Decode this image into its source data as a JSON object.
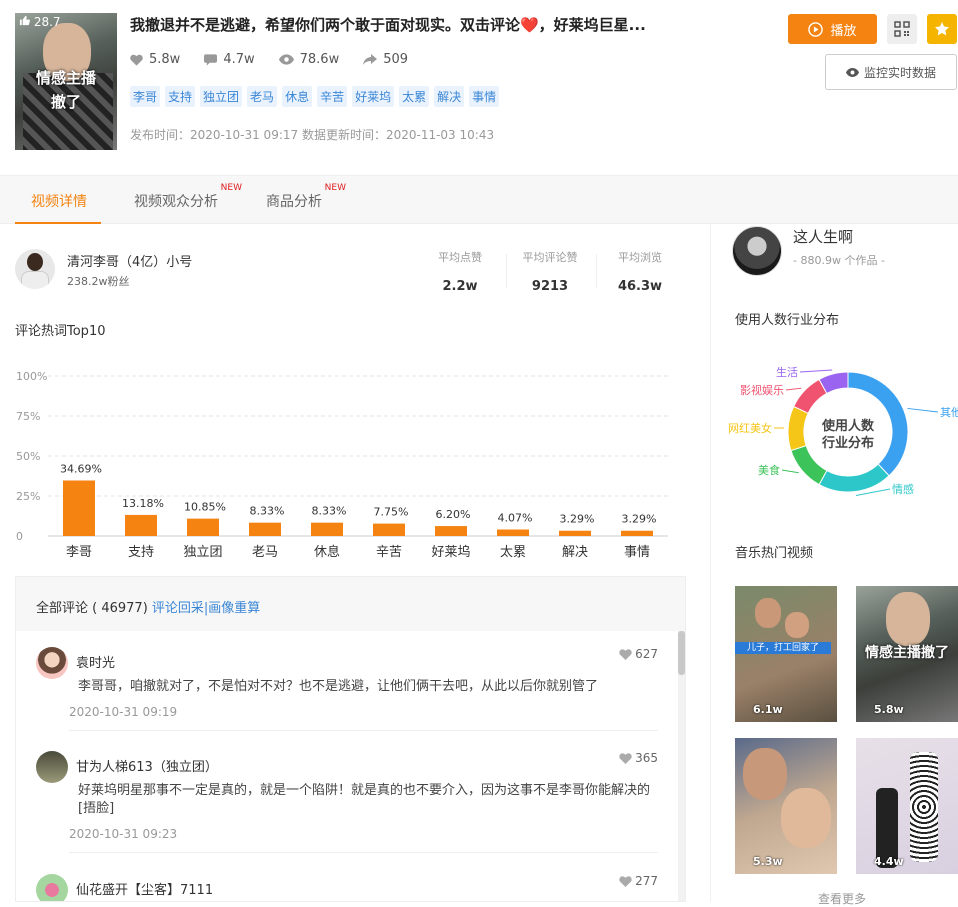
{
  "video": {
    "title": "我撤退并不是逃避，希望你们两个敢于面对现实。双击评论❤️，好莱坞巨星...",
    "score": "28.7",
    "cover_caption_1": "情感主播",
    "cover_caption_2": "撤了",
    "likes": "5.8w",
    "comments": "4.7w",
    "views": "78.6w",
    "shares": "509",
    "tags": [
      "李哥",
      "支持",
      "独立团",
      "老马",
      "休息",
      "辛苦",
      "好莱坞",
      "太累",
      "解决",
      "事情"
    ],
    "publish_info": "发布时间：2020-10-31 09:17 数据更新时间：2020-11-03 10:43"
  },
  "actions": {
    "play": "播放",
    "monitor": "监控实时数据",
    "icons": [
      "play-circle-icon",
      "qrcode-icon",
      "star-icon",
      "eye-icon"
    ]
  },
  "tabs": [
    {
      "label": "视频详情",
      "badge": ""
    },
    {
      "label": "视频观众分析",
      "badge": "NEW"
    },
    {
      "label": "商品分析",
      "badge": "NEW"
    }
  ],
  "author": {
    "name": "清河李哥（4亿）小号",
    "fans": "238.2w粉丝",
    "avg_likes_label": "平均点赞",
    "avg_likes": "2.2w",
    "avg_comment_likes_label": "平均评论赞",
    "avg_comment_likes": "9213",
    "avg_views_label": "平均浏览",
    "avg_views": "46.3w"
  },
  "hot_words_title": "评论热词Top10",
  "chart_data": {
    "type": "bar",
    "categories": [
      "李哥",
      "支持",
      "独立团",
      "老马",
      "休息",
      "辛苦",
      "好莱坞",
      "太累",
      "解决",
      "事情"
    ],
    "values": [
      34.69,
      13.18,
      10.85,
      8.33,
      8.33,
      7.75,
      6.2,
      4.07,
      3.29,
      3.29
    ],
    "data_labels": [
      "34.69%",
      "13.18%",
      "10.85%",
      "8.33%",
      "8.33%",
      "7.75%",
      "6.20%",
      "4.07%",
      "3.29%",
      "3.29%"
    ],
    "ylim": [
      0,
      100
    ],
    "yticks": [
      0,
      25,
      50,
      75,
      100
    ],
    "ytick_labels": [
      "0",
      "25%",
      "50%",
      "75%",
      "100%"
    ],
    "grid": true,
    "bar_color": "#f48311"
  },
  "comments": {
    "header_label": "全部评论 ( 46977)",
    "header_link": "评论回采|画像重算",
    "items": [
      {
        "user": "袁时光",
        "likes": "627",
        "text": "李哥哥，咱撤就对了，不是怕对不对？也不是逃避，让他们俩干去吧，从此以后你就别管了",
        "date": "2020-10-31 09:19"
      },
      {
        "user": "甘为人梯613（独立团）",
        "likes": "365",
        "text": "好莱坞明星那事不一定是真的，就是一个陷阱！就是真的也不要介入，因为这事不是李哥你能解决的[捂脸]",
        "date": "2020-10-31 09:23"
      },
      {
        "user": "仙花盛开【尘客】7111",
        "likes": "277",
        "text": "",
        "date": ""
      }
    ]
  },
  "music": {
    "name": "这人生啊",
    "works": "- 880.9w 个作品 -",
    "industry_title": "使用人数行业分布",
    "donut_center_1": "使用人数",
    "donut_center_2": "行业分布",
    "hot_videos_title": "音乐热门视频",
    "more": "查看更多",
    "industry": [
      {
        "name": "其他",
        "value": 38,
        "color": "#3aa0f0"
      },
      {
        "name": "情感",
        "value": 20,
        "color": "#2ec7c9"
      },
      {
        "name": "美食",
        "value": 12,
        "color": "#3cc35a"
      },
      {
        "name": "网红美女",
        "value": 12,
        "color": "#f5c518"
      },
      {
        "name": "影视娱乐",
        "value": 10,
        "color": "#f0536f"
      },
      {
        "name": "生活",
        "value": 8,
        "color": "#9a63f0"
      }
    ],
    "videos": [
      {
        "count": "6.1w",
        "caption": "儿子，打工回家了"
      },
      {
        "count": "5.8w",
        "caption": "情感主播撤了"
      },
      {
        "count": "5.3w",
        "caption": ""
      },
      {
        "count": "4.4w",
        "caption": ""
      }
    ]
  }
}
